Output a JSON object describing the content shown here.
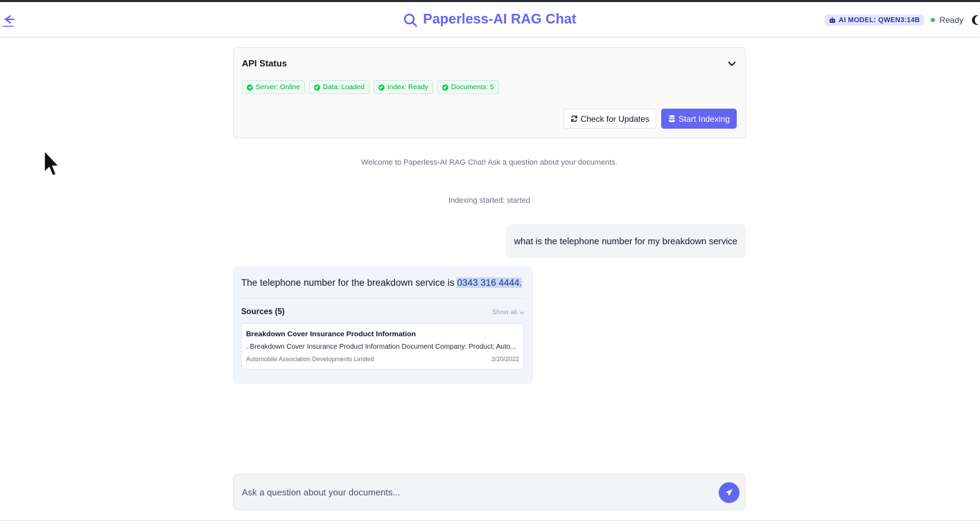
{
  "header": {
    "title": "Paperless-AI RAG Chat",
    "model_label": "AI MODEL: QWEN3:14B",
    "status": "Ready",
    "icons": [
      "arrow-left-icon",
      "search-icon",
      "robot-icon",
      "moon-icon"
    ]
  },
  "api_status": {
    "title": "API Status",
    "badges": [
      "Server: Online",
      "Data: Loaded",
      "Index: Ready",
      "Documents: 5"
    ],
    "check_updates_label": "Check for Updates",
    "start_indexing_label": "Start Indexing"
  },
  "chat": {
    "welcome": "Welcome to Paperless-AI RAG Chat! Ask a question about your documents.",
    "indexing_msg": "Indexing started: started",
    "user_message": "what is the telephone number for my breakdown service",
    "bot_prefix": "The telephone number for the breakdown service is ",
    "bot_highlight": "0343 316 4444.",
    "sources_label": "Sources (5)",
    "show_all_label": "Show all",
    "source": {
      "title": "Breakdown Cover Insurance Product Information",
      "snippet": ". Breakdown Cover Insurance Product Information Document Company: Product: Auto...",
      "company": "Automobile Association Developments Limited",
      "date": "2/20/2022"
    }
  },
  "input": {
    "placeholder": "Ask a question about your documents..."
  },
  "colors": {
    "accent": "#6366f1",
    "success": "#22c55e"
  }
}
